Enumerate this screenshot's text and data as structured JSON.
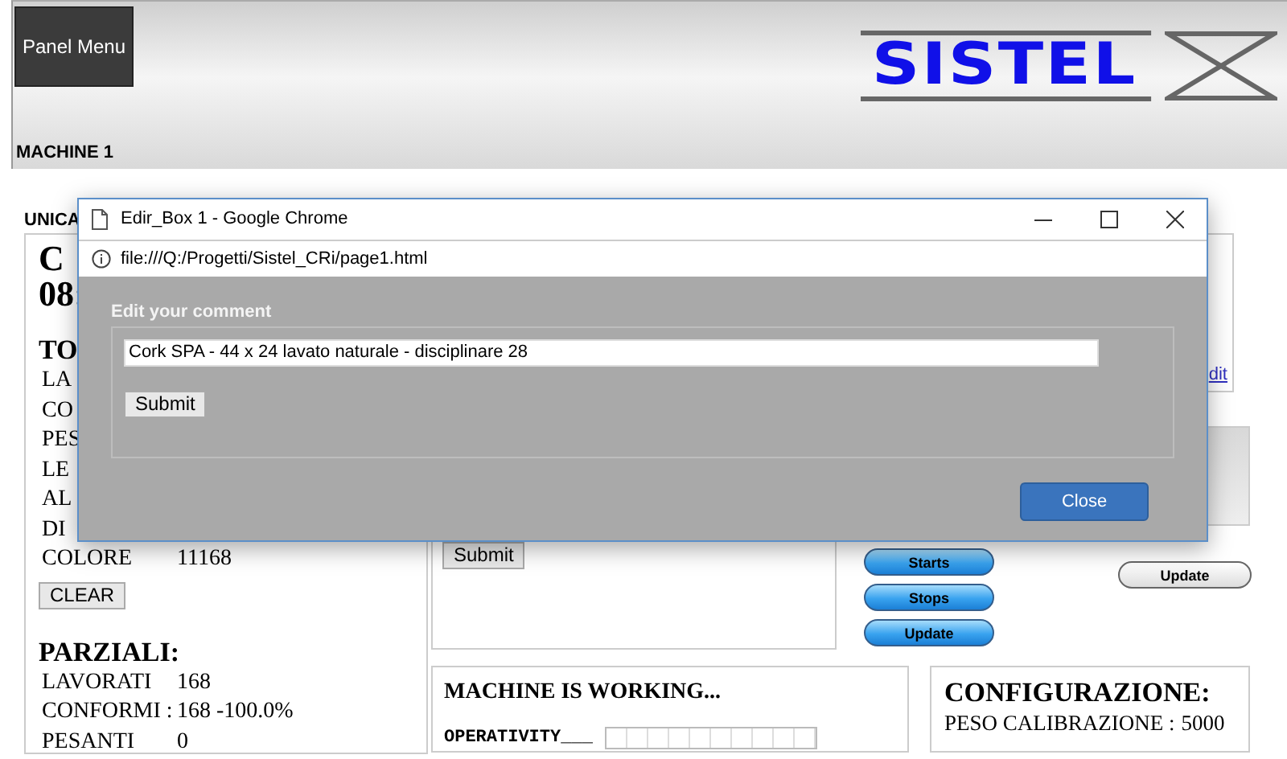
{
  "header": {
    "menu_button": "Panel Menu",
    "logo": "SISTEL",
    "machine": "MACHINE 1"
  },
  "section_label": "UNICA",
  "left_panel": {
    "title_lines": [
      "C",
      "08:"
    ],
    "totals_heading": "TO",
    "total_rows": [
      {
        "label": "LA"
      },
      {
        "label": "CO"
      },
      {
        "label": "PES"
      },
      {
        "label": "LE"
      },
      {
        "label": "AL"
      },
      {
        "label": "DI"
      },
      {
        "label": "COLORE",
        "value": "11168"
      }
    ],
    "clear_button": "CLEAR",
    "partials_heading": "PARZIALI:",
    "partial_rows": [
      {
        "label": "LAVORATI",
        "value": "168"
      },
      {
        "label": "CONFORMI :",
        "value": "168 -100.0%"
      },
      {
        "label": "PESANTI",
        "value": "0"
      }
    ]
  },
  "comment_panel": {
    "submit_button": "Submit"
  },
  "info_panel": {
    "link": "dit"
  },
  "action_buttons": [
    "Starts",
    "Stops",
    "Update"
  ],
  "update_button": "Update",
  "status_panel": {
    "title": "MACHINE IS WORKING...",
    "meters": [
      {
        "label": "OPERATIVITY___",
        "level": 0
      }
    ]
  },
  "config_panel": {
    "title": "CONFIGURAZIONE:",
    "rows": [
      {
        "label": "PESO CALIBRAZIONE :",
        "value": "5000"
      }
    ]
  },
  "popup": {
    "title": "Edir_Box 1 - Google Chrome",
    "url": "file:///Q:/Progetti/Sistel_CRi/page1.html",
    "legend": "Edit your comment",
    "comment": "Cork SPA - 44 x 24 lavato naturale - disciplinare 28",
    "submit_button": "Submit",
    "close_button": "Close"
  }
}
